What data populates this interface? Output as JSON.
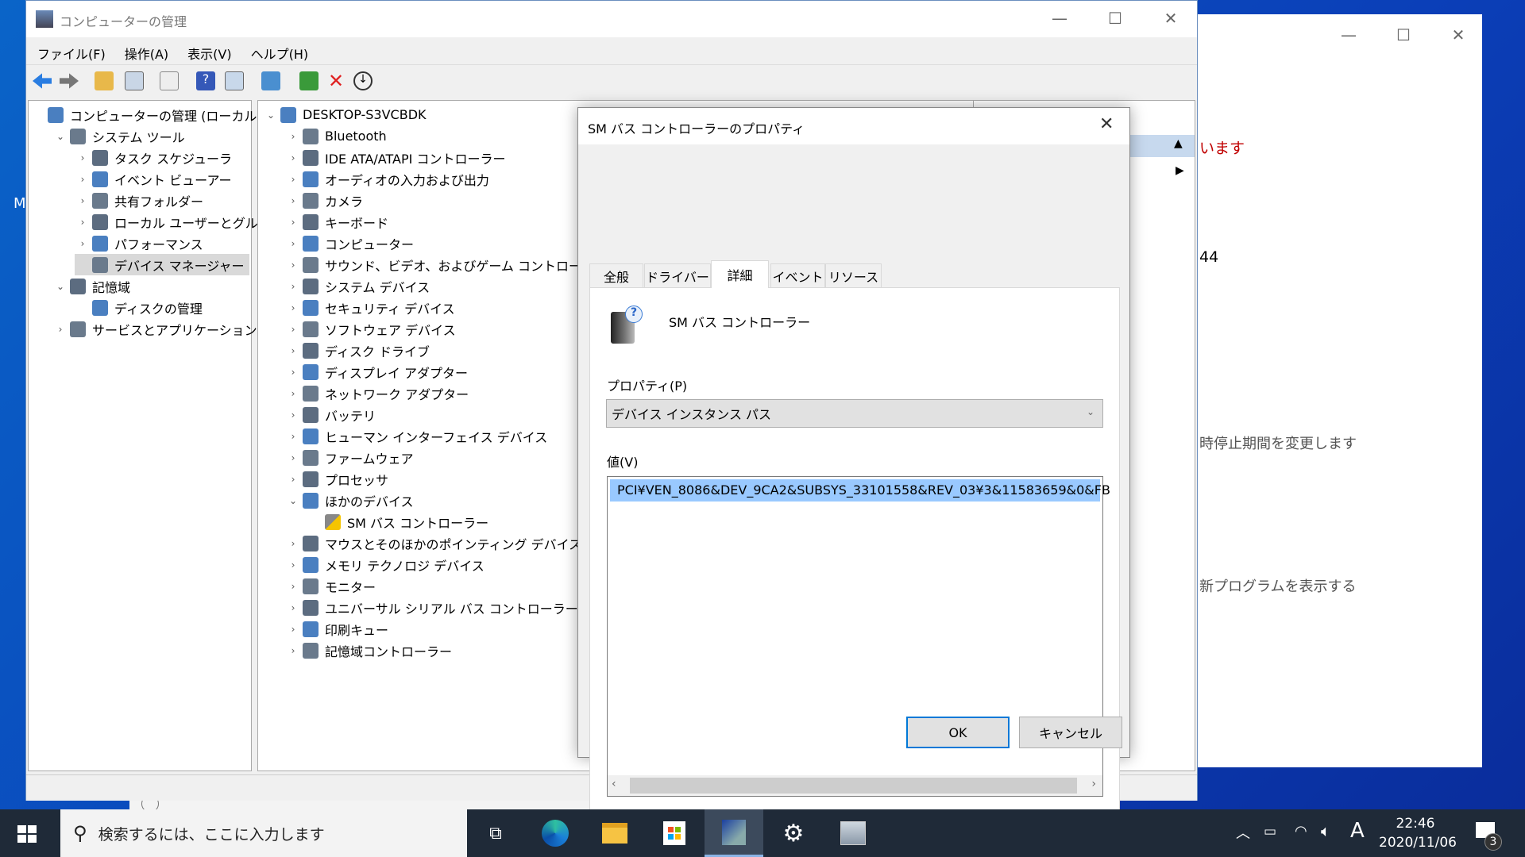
{
  "desktop": {
    "edge_label": "M"
  },
  "background_window": {
    "texts": [
      "います",
      "44",
      "時停止期間を変更します",
      "新プログラムを表示する"
    ],
    "accent": "#c00000"
  },
  "main_window": {
    "title": "コンピューターの管理",
    "menu": [
      "ファイル(F)",
      "操作(A)",
      "表示(V)",
      "ヘルプ(H)"
    ],
    "toolbar": [
      "back-icon",
      "forward-icon",
      "up-folder-icon",
      "show-hide-tree-icon",
      "properties-icon",
      "help-icon",
      "action-pane-icon",
      "monitor-icon",
      "update-driver-icon",
      "uninstall-icon",
      "download-icon"
    ],
    "left_tree": [
      {
        "label": "コンピューターの管理 (ローカル)",
        "level": 0,
        "chev": ""
      },
      {
        "label": "システム ツール",
        "level": 1,
        "chev": "v"
      },
      {
        "label": "タスク スケジューラ",
        "level": 2,
        "chev": ">"
      },
      {
        "label": "イベント ビューアー",
        "level": 2,
        "chev": ">"
      },
      {
        "label": "共有フォルダー",
        "level": 2,
        "chev": ">"
      },
      {
        "label": "ローカル ユーザーとグループ",
        "level": 2,
        "chev": ">"
      },
      {
        "label": "パフォーマンス",
        "level": 2,
        "chev": ">"
      },
      {
        "label": "デバイス マネージャー",
        "level": 2,
        "chev": "",
        "selected": true
      },
      {
        "label": "記憶域",
        "level": 1,
        "chev": "v"
      },
      {
        "label": "ディスクの管理",
        "level": 2,
        "chev": ""
      },
      {
        "label": "サービスとアプリケーション",
        "level": 1,
        "chev": ">"
      }
    ],
    "device_tree": [
      {
        "label": "DESKTOP-S3VCBDK",
        "level": 0,
        "chev": "v"
      },
      {
        "label": "Bluetooth",
        "level": 1,
        "chev": ">"
      },
      {
        "label": "IDE ATA/ATAPI コントローラー",
        "level": 1,
        "chev": ">"
      },
      {
        "label": "オーディオの入力および出力",
        "level": 1,
        "chev": ">"
      },
      {
        "label": "カメラ",
        "level": 1,
        "chev": ">"
      },
      {
        "label": "キーボード",
        "level": 1,
        "chev": ">"
      },
      {
        "label": "コンピューター",
        "level": 1,
        "chev": ">"
      },
      {
        "label": "サウンド、ビデオ、およびゲーム コントローラー",
        "level": 1,
        "chev": ">"
      },
      {
        "label": "システム デバイス",
        "level": 1,
        "chev": ">"
      },
      {
        "label": "セキュリティ デバイス",
        "level": 1,
        "chev": ">"
      },
      {
        "label": "ソフトウェア デバイス",
        "level": 1,
        "chev": ">"
      },
      {
        "label": "ディスク ドライブ",
        "level": 1,
        "chev": ">"
      },
      {
        "label": "ディスプレイ アダプター",
        "level": 1,
        "chev": ">"
      },
      {
        "label": "ネットワーク アダプター",
        "level": 1,
        "chev": ">"
      },
      {
        "label": "バッテリ",
        "level": 1,
        "chev": ">"
      },
      {
        "label": "ヒューマン インターフェイス デバイス",
        "level": 1,
        "chev": ">"
      },
      {
        "label": "ファームウェア",
        "level": 1,
        "chev": ">"
      },
      {
        "label": "プロセッサ",
        "level": 1,
        "chev": ">"
      },
      {
        "label": "ほかのデバイス",
        "level": 1,
        "chev": "v"
      },
      {
        "label": "SM バス コントローラー",
        "level": 2,
        "chev": "",
        "warning": true
      },
      {
        "label": "マウスとそのほかのポインティング デバイス",
        "level": 1,
        "chev": ">"
      },
      {
        "label": "メモリ テクノロジ デバイス",
        "level": 1,
        "chev": ">"
      },
      {
        "label": "モニター",
        "level": 1,
        "chev": ">"
      },
      {
        "label": "ユニバーサル シリアル バス コントローラー",
        "level": 1,
        "chev": ">"
      },
      {
        "label": "印刷キュー",
        "level": 1,
        "chev": ">"
      },
      {
        "label": "記憶域コントローラー",
        "level": 1,
        "chev": ">"
      }
    ]
  },
  "dialog": {
    "title": "SM バス コントローラーのプロパティ",
    "tabs": [
      "全般",
      "ドライバー",
      "詳細",
      "イベント",
      "リソース"
    ],
    "active_tab": "詳細",
    "device_name": "SM バス コントローラー",
    "property_label": "プロパティ(P)",
    "property_value": "デバイス インスタンス パス",
    "value_label": "値(V)",
    "values": [
      "PCI¥VEN_8086&DEV_9CA2&SUBSYS_33101558&REV_03¥3&11583659&0&FB"
    ],
    "ok": "OK",
    "cancel": "キャンセル"
  },
  "taskbar": {
    "search_placeholder": "検索するには、ここに入力します",
    "apps": [
      "task-view-icon",
      "edge-icon",
      "file-explorer-icon",
      "store-icon",
      "computer-management-icon",
      "settings-icon",
      "performance-monitor-icon"
    ],
    "active_app": "computer-management-icon",
    "ime": "A",
    "time": "22:46",
    "date": "2020/11/06",
    "notifications": "3"
  }
}
